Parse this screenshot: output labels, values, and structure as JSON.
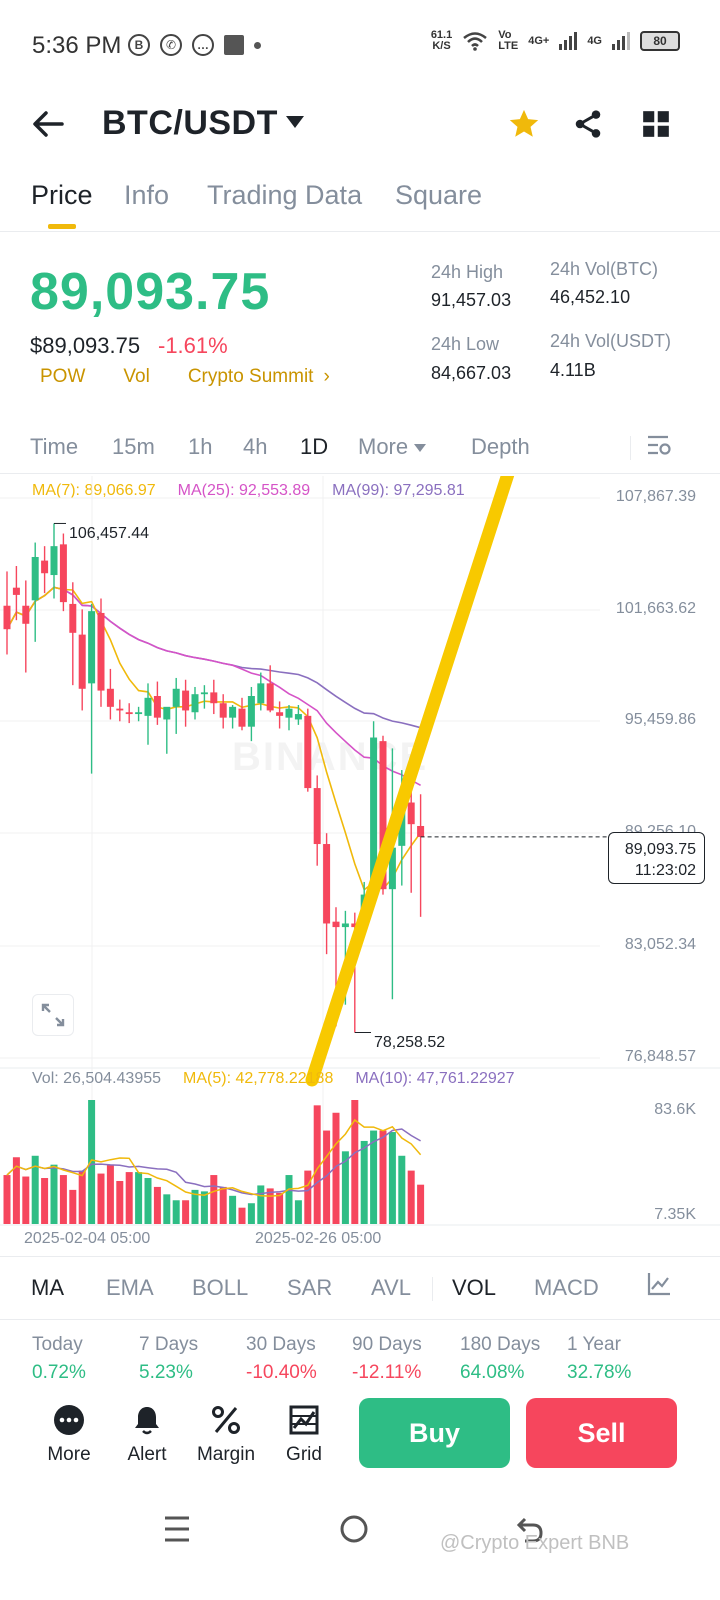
{
  "status_bar": {
    "time": "5:36 PM",
    "left_icons": [
      "b-icon",
      "whatsapp-icon",
      "chat-icon",
      "square-icon",
      "dot-icon"
    ],
    "net_speed_value": "61.1",
    "net_speed_unit": "K/S",
    "volte_top": "Vo",
    "volte_bottom": "LTE",
    "net1": "4G+",
    "net2": "4G",
    "battery": "80"
  },
  "header": {
    "pair": "BTC/USDT",
    "favorite_color": "#f0b90b"
  },
  "tabs": [
    "Price",
    "Info",
    "Trading Data",
    "Square"
  ],
  "active_tab": "Price",
  "price": {
    "last": "89,093.75",
    "usd": "$89,093.75",
    "change_pct": "-1.61%",
    "tags": [
      "POW",
      "Vol",
      "Crypto Summit"
    ],
    "tags_more": "›"
  },
  "stats": {
    "high_label": "24h High",
    "high_value": "91,457.03",
    "low_label": "24h Low",
    "low_value": "84,667.03",
    "vol_btc_label": "24h Vol(BTC)",
    "vol_btc_value": "46,452.10",
    "vol_usdt_label": "24h Vol(USDT)",
    "vol_usdt_value": "4.11B"
  },
  "intervals": [
    "Time",
    "15m",
    "1h",
    "4h",
    "1D",
    "More",
    "Depth"
  ],
  "active_interval": "1D",
  "ma_labels": {
    "ma7": "MA(7): 89,066.97",
    "ma25": "MA(25): 92,553.89",
    "ma99": "MA(99): 97,295.81"
  },
  "axis_labels": [
    "107,867.39",
    "101,663.62",
    "95,459.86",
    "89,256.10",
    "83,052.34",
    "76,848.57"
  ],
  "current_price_tag": {
    "price": "89,093.75",
    "countdown": "11:23:02"
  },
  "high_marker": "106,457.44",
  "low_marker": "78,258.52",
  "watermark": "BINANCE",
  "vol_labels": {
    "vol": "Vol: 26,504.43955",
    "ma5": "MA(5): 42,778.22188",
    "ma10": "MA(10): 47,761.22927"
  },
  "vol_axis": [
    "83.6K",
    "7.35K"
  ],
  "dates": [
    "2025-02-04 05:00",
    "2025-02-26 05:00"
  ],
  "indicators": [
    "MA",
    "EMA",
    "BOLL",
    "SAR",
    "AVL",
    "VOL",
    "MACD"
  ],
  "active_indicators": [
    "MA",
    "VOL"
  ],
  "performance": [
    {
      "label": "Today",
      "value": "0.72%"
    },
    {
      "label": "7 Days",
      "value": "5.23%"
    },
    {
      "label": "30 Days",
      "value": "-10.40%"
    },
    {
      "label": "90 Days",
      "value": "-12.11%"
    },
    {
      "label": "180 Days",
      "value": "64.08%"
    },
    {
      "label": "1 Year",
      "value": "32.78%"
    }
  ],
  "actions": [
    "More",
    "Alert",
    "Margin",
    "Grid"
  ],
  "buy_label": "Buy",
  "sell_label": "Sell",
  "credit": "@Crypto Expert BNB",
  "colors": {
    "up": "#2ebd85",
    "down": "#f6465d",
    "ma7": "#f0b90b",
    "ma25": "#d553c7",
    "ma99": "#8a6fbf",
    "accent": "#f0b90b"
  },
  "chart_data": {
    "type": "candlestick",
    "price_range": [
      76848.57,
      107867.39
    ],
    "candles": [
      {
        "o": 101900,
        "h": 103800,
        "l": 99200,
        "c": 100600
      },
      {
        "o": 102900,
        "h": 104100,
        "l": 101100,
        "c": 102500
      },
      {
        "o": 101900,
        "h": 103300,
        "l": 98200,
        "c": 100900
      },
      {
        "o": 102200,
        "h": 105400,
        "l": 99900,
        "c": 104600
      },
      {
        "o": 104400,
        "h": 105200,
        "l": 102600,
        "c": 103700
      },
      {
        "o": 103600,
        "h": 106457.44,
        "l": 102300,
        "c": 105200
      },
      {
        "o": 105300,
        "h": 105900,
        "l": 101600,
        "c": 102100
      },
      {
        "o": 102000,
        "h": 103200,
        "l": 97500,
        "c": 100400
      },
      {
        "o": 100300,
        "h": 101700,
        "l": 96100,
        "c": 97300
      },
      {
        "o": 97600,
        "h": 102000,
        "l": 92600,
        "c": 101600
      },
      {
        "o": 101500,
        "h": 102300,
        "l": 96300,
        "c": 97200
      },
      {
        "o": 97300,
        "h": 98400,
        "l": 95600,
        "c": 96300
      },
      {
        "o": 96200,
        "h": 96700,
        "l": 95500,
        "c": 96100
      },
      {
        "o": 96000,
        "h": 96500,
        "l": 95400,
        "c": 95900
      },
      {
        "o": 95900,
        "h": 96300,
        "l": 95500,
        "c": 96000
      },
      {
        "o": 95800,
        "h": 97600,
        "l": 94200,
        "c": 96800
      },
      {
        "o": 96900,
        "h": 97700,
        "l": 95300,
        "c": 95700
      },
      {
        "o": 95600,
        "h": 96200,
        "l": 93700,
        "c": 96300
      },
      {
        "o": 96300,
        "h": 97900,
        "l": 94800,
        "c": 97300
      },
      {
        "o": 97200,
        "h": 97800,
        "l": 95200,
        "c": 96100
      },
      {
        "o": 96000,
        "h": 97400,
        "l": 95600,
        "c": 97000
      },
      {
        "o": 97000,
        "h": 97500,
        "l": 96200,
        "c": 97100
      },
      {
        "o": 97100,
        "h": 97800,
        "l": 95900,
        "c": 96500
      },
      {
        "o": 96500,
        "h": 97000,
        "l": 95100,
        "c": 95700
      },
      {
        "o": 95700,
        "h": 96400,
        "l": 95100,
        "c": 96300
      },
      {
        "o": 96200,
        "h": 96800,
        "l": 95000,
        "c": 95200
      },
      {
        "o": 95200,
        "h": 97400,
        "l": 94400,
        "c": 96900
      },
      {
        "o": 96500,
        "h": 98200,
        "l": 96100,
        "c": 97600
      },
      {
        "o": 97600,
        "h": 98600,
        "l": 96000,
        "c": 96100
      },
      {
        "o": 96000,
        "h": 96600,
        "l": 95100,
        "c": 95800
      },
      {
        "o": 95700,
        "h": 96400,
        "l": 95000,
        "c": 96200
      },
      {
        "o": 95600,
        "h": 96400,
        "l": 95300,
        "c": 95900
      },
      {
        "o": 95800,
        "h": 96200,
        "l": 91600,
        "c": 91800
      },
      {
        "o": 91800,
        "h": 92500,
        "l": 87500,
        "c": 88700
      },
      {
        "o": 88700,
        "h": 89300,
        "l": 82600,
        "c": 84300
      },
      {
        "o": 84400,
        "h": 85200,
        "l": 78600,
        "c": 84100
      },
      {
        "o": 84100,
        "h": 85000,
        "l": 79800,
        "c": 84300
      },
      {
        "o": 84300,
        "h": 84900,
        "l": 78258.52,
        "c": 84100
      },
      {
        "o": 84200,
        "h": 86600,
        "l": 83900,
        "c": 85900
      },
      {
        "o": 85900,
        "h": 95500,
        "l": 85300,
        "c": 94600
      },
      {
        "o": 94400,
        "h": 94700,
        "l": 85900,
        "c": 86200
      },
      {
        "o": 86200,
        "h": 94000,
        "l": 80100,
        "c": 88500
      },
      {
        "o": 88600,
        "h": 92800,
        "l": 86400,
        "c": 91200
      },
      {
        "o": 91000,
        "h": 92200,
        "l": 86000,
        "c": 89800
      },
      {
        "o": 89700,
        "h": 91457.03,
        "l": 84667.03,
        "c": 89093.75
      }
    ],
    "volume_range": [
      0,
      83600
    ],
    "volumes": [
      33000,
      45000,
      32000,
      46000,
      31000,
      40000,
      33000,
      23000,
      36000,
      83600,
      34000,
      40000,
      29000,
      35000,
      35000,
      31000,
      25000,
      20000,
      16000,
      16000,
      23000,
      22000,
      33000,
      25000,
      19000,
      11000,
      14000,
      26000,
      24000,
      21000,
      33000,
      16000,
      36000,
      80000,
      63000,
      75000,
      49000,
      83600,
      56000,
      63000,
      63000,
      62000,
      46000,
      36000,
      26504
    ]
  }
}
